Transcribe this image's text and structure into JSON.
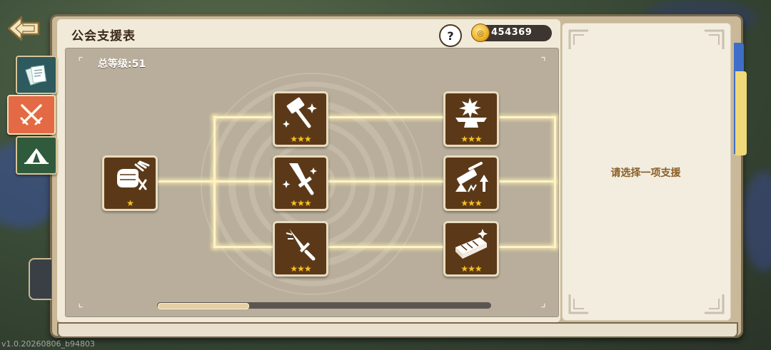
{
  "header": {
    "title": "公会支援表",
    "help_label": "?",
    "currency_value": "454369"
  },
  "board": {
    "total_level": "总等级:51",
    "nodes": [
      {
        "id": "root",
        "icon": "gloved-fist-icon",
        "stars": "★"
      },
      {
        "id": "hammer",
        "icon": "hammer-icon",
        "stars": "★★★"
      },
      {
        "id": "sword",
        "icon": "sword-icon",
        "stars": "★★★"
      },
      {
        "id": "dagger",
        "icon": "dagger-icon",
        "stars": "★★★"
      },
      {
        "id": "anvil",
        "icon": "anvil-icon",
        "stars": "★★★"
      },
      {
        "id": "upgrade",
        "icon": "forge-upgrade-icon",
        "stars": "★★★"
      },
      {
        "id": "ingot",
        "icon": "metal-bar-icon",
        "stars": "★★★"
      }
    ],
    "scroll_progress": 0.27
  },
  "detail": {
    "hint": "请选择一项支援"
  },
  "sidebar": {
    "tabs": [
      {
        "icon": "documents-icon",
        "active": false
      },
      {
        "icon": "crossed-swords-icon",
        "active": true
      },
      {
        "icon": "tent-icon",
        "active": false
      }
    ]
  },
  "footer": {
    "version": "v1.0.20260806_b94803"
  },
  "colors": {
    "node_bg": "#5b3918",
    "glow_line": "#fff3c9",
    "active_tab": "#e36a45",
    "star": "#f6bf2a"
  }
}
